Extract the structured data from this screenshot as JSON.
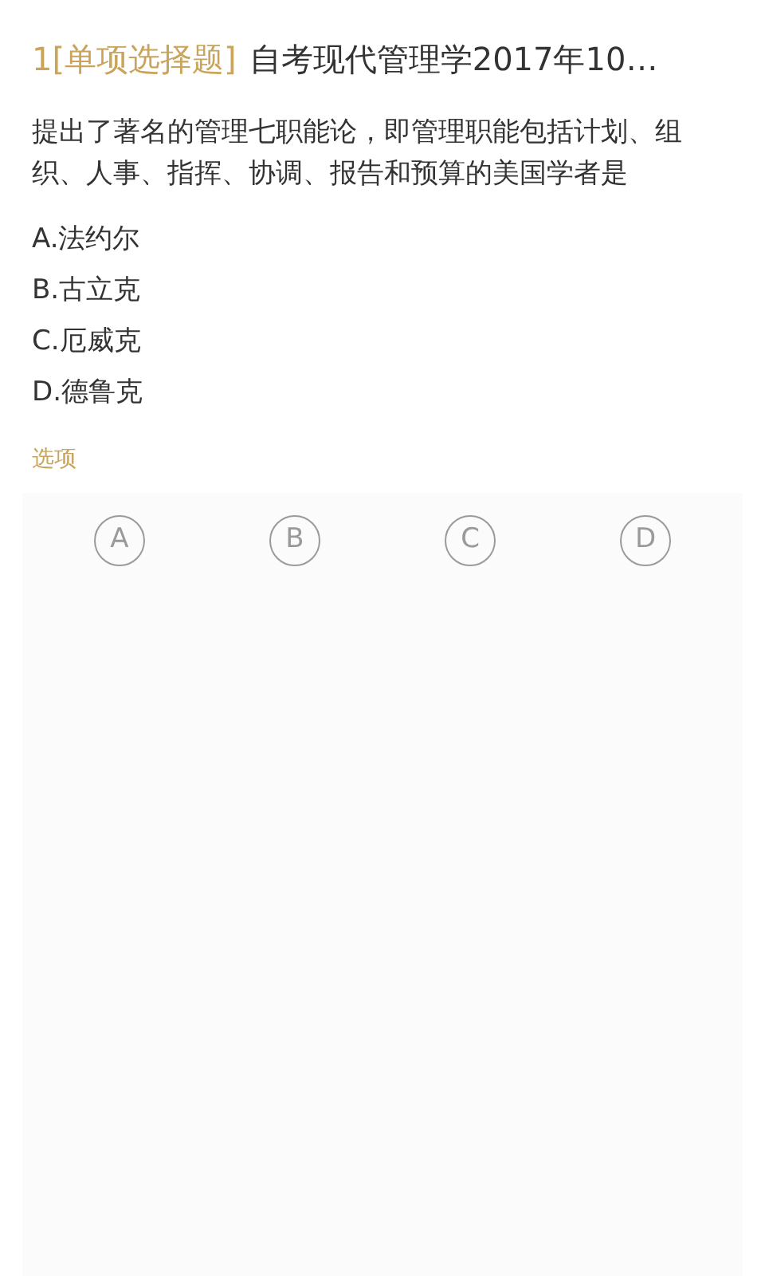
{
  "question": {
    "number": "1",
    "type": "[单项选择题]",
    "title": "自考现代管理学2017年10…",
    "text": "提出了著名的管理七职能论，即管理职能包括计划、组织、人事、指挥、协调、报告和预算的美国学者是",
    "options": [
      "A.法约尔",
      "B.古立克",
      "C.厄威克",
      "D.德鲁克"
    ]
  },
  "answer": {
    "label": "选项",
    "choices": [
      {
        "letter": "A",
        "selected": false
      },
      {
        "letter": "B",
        "selected": false
      },
      {
        "letter": "C",
        "selected": false
      },
      {
        "letter": "D",
        "selected": false
      }
    ]
  }
}
